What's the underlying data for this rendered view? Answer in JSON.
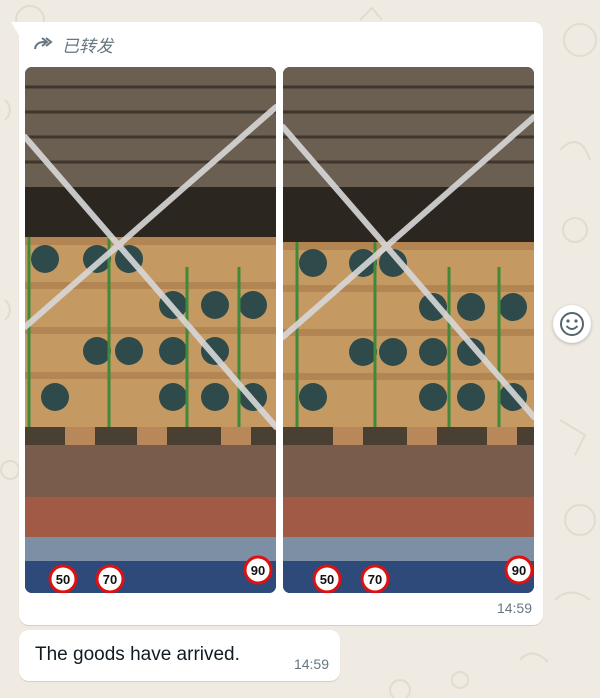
{
  "chat": {
    "background_color": "#efeae2",
    "bubble_color": "#ffffff",
    "meta_color": "#667781"
  },
  "messages": [
    {
      "type": "media",
      "forwarded_label": "已转发",
      "forwarded_icon": "forward-arrow-icon",
      "images": [
        {
          "description_icon": "container-photo"
        },
        {
          "description_icon": "container-photo"
        }
      ],
      "time": "14:59",
      "photo_labels": [
        "50",
        "70",
        "90"
      ]
    },
    {
      "type": "text",
      "text": "The goods have arrived.",
      "time": "14:59"
    }
  ],
  "actions": {
    "reaction_icon": "emoji-smiley-icon"
  }
}
